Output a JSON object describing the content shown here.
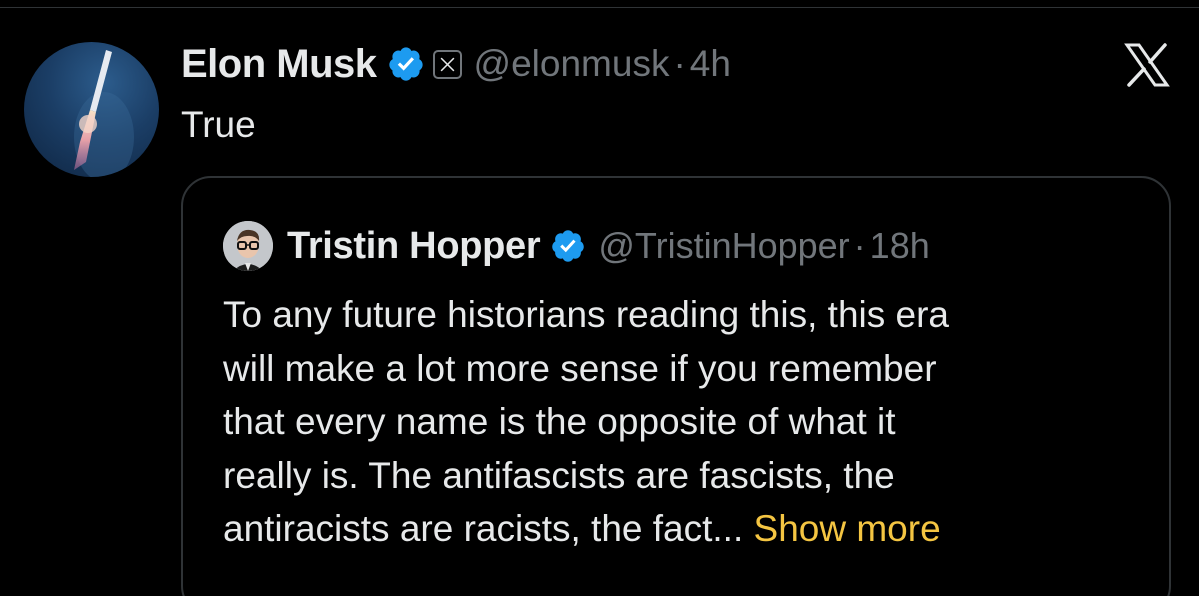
{
  "tweet": {
    "author": {
      "display_name": "Elon Musk",
      "handle": "@elonmusk",
      "verified": true,
      "affiliation_badge": "x-logo-badge",
      "avatar": "rocket-launch-avatar"
    },
    "separator": "·",
    "time": "4h",
    "text": "True"
  },
  "platform_logo": "x-logo-icon",
  "quoted_tweet": {
    "author": {
      "display_name": "Tristin Hopper",
      "handle": "@TristinHopper",
      "verified": true,
      "avatar": "person-with-glasses-avatar"
    },
    "separator": "·",
    "time": "18h",
    "text_lines": [
      "To any future historians reading this, this era",
      "will make a lot more sense if you remember",
      "that every name is the opposite of what it",
      "really is. The antifascists are fascists, the",
      "antiracists are racists, the fact..."
    ],
    "show_more_label": " Show more"
  },
  "colors": {
    "background": "#000000",
    "primary_text": "#e7e9ea",
    "secondary_text": "#71767b",
    "verified_blue": "#1d9bf0",
    "show_more": "#f4c542",
    "border": "#2f3336"
  }
}
